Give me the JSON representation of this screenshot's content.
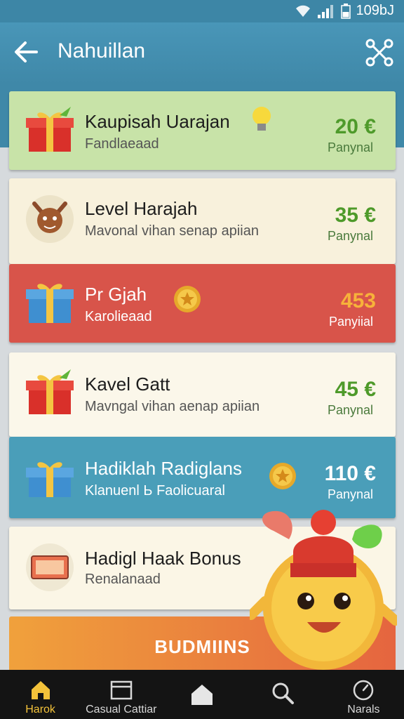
{
  "status": {
    "time": "109bJ"
  },
  "appbar": {
    "title": "Nahuillan",
    "back_icon": "arrow-left-icon",
    "share_icon": "share-network-icon"
  },
  "cards": [
    {
      "title": "Kaupisah Uarajan",
      "subtitle": "Fandlaeaad",
      "price": "20 €",
      "price_label": "Panynal",
      "bg": "#c8e3a8",
      "icon": "gift-box-icon",
      "accent": "lightbulb-icon"
    },
    {
      "title": "Level Harajah",
      "subtitle": "Mavonal vihan senap apiian",
      "price": "35 €",
      "price_label": "Panynal",
      "bg": "#f8f1dc",
      "icon": "creature-avatar-icon",
      "accent": ""
    },
    {
      "title": "Pr Gjah",
      "subtitle": "Karolieaad",
      "price": "453",
      "price_label": "Panyiial",
      "bg": "#d8544a",
      "icon": "gift-box-icon",
      "accent": "gold-coin-icon"
    },
    {
      "title": "Kavel Gatt",
      "subtitle": "Mavngal vihan aenap apiian",
      "price": "45 €",
      "price_label": "Panynal",
      "bg": "#fbf7ea",
      "icon": "gift-box-icon",
      "accent": ""
    },
    {
      "title": "Hadiklah Radiglans",
      "subtitle": "Klanuenl Ь Faolicuaral",
      "price": "110 €",
      "price_label": "Panynal",
      "bg": "#4a9eb9",
      "icon": "gift-box-icon",
      "accent": "gold-coin-icon"
    },
    {
      "title": "Hadigl Haak Bonus",
      "subtitle": "Renalanaad",
      "price": "",
      "price_label": "",
      "bg": "#fbf6e6",
      "icon": "ticket-icon",
      "accent": ""
    }
  ],
  "banner": {
    "label": "BUDMIINS"
  },
  "nav": [
    {
      "label": "Harok",
      "icon": "home-icon",
      "active": true
    },
    {
      "label": "Casual Cattiar",
      "icon": "inbox-icon",
      "active": false
    },
    {
      "label": "",
      "icon": "house-shape-icon",
      "active": false
    },
    {
      "label": "",
      "icon": "search-icon",
      "active": false
    },
    {
      "label": "Narals",
      "icon": "clock-icon",
      "active": false
    }
  ],
  "colors": {
    "appbar": "#3f88a8",
    "price_green": "#4e9a2a",
    "price_orange": "#f7b23a",
    "nav_active": "#f3c23a"
  }
}
